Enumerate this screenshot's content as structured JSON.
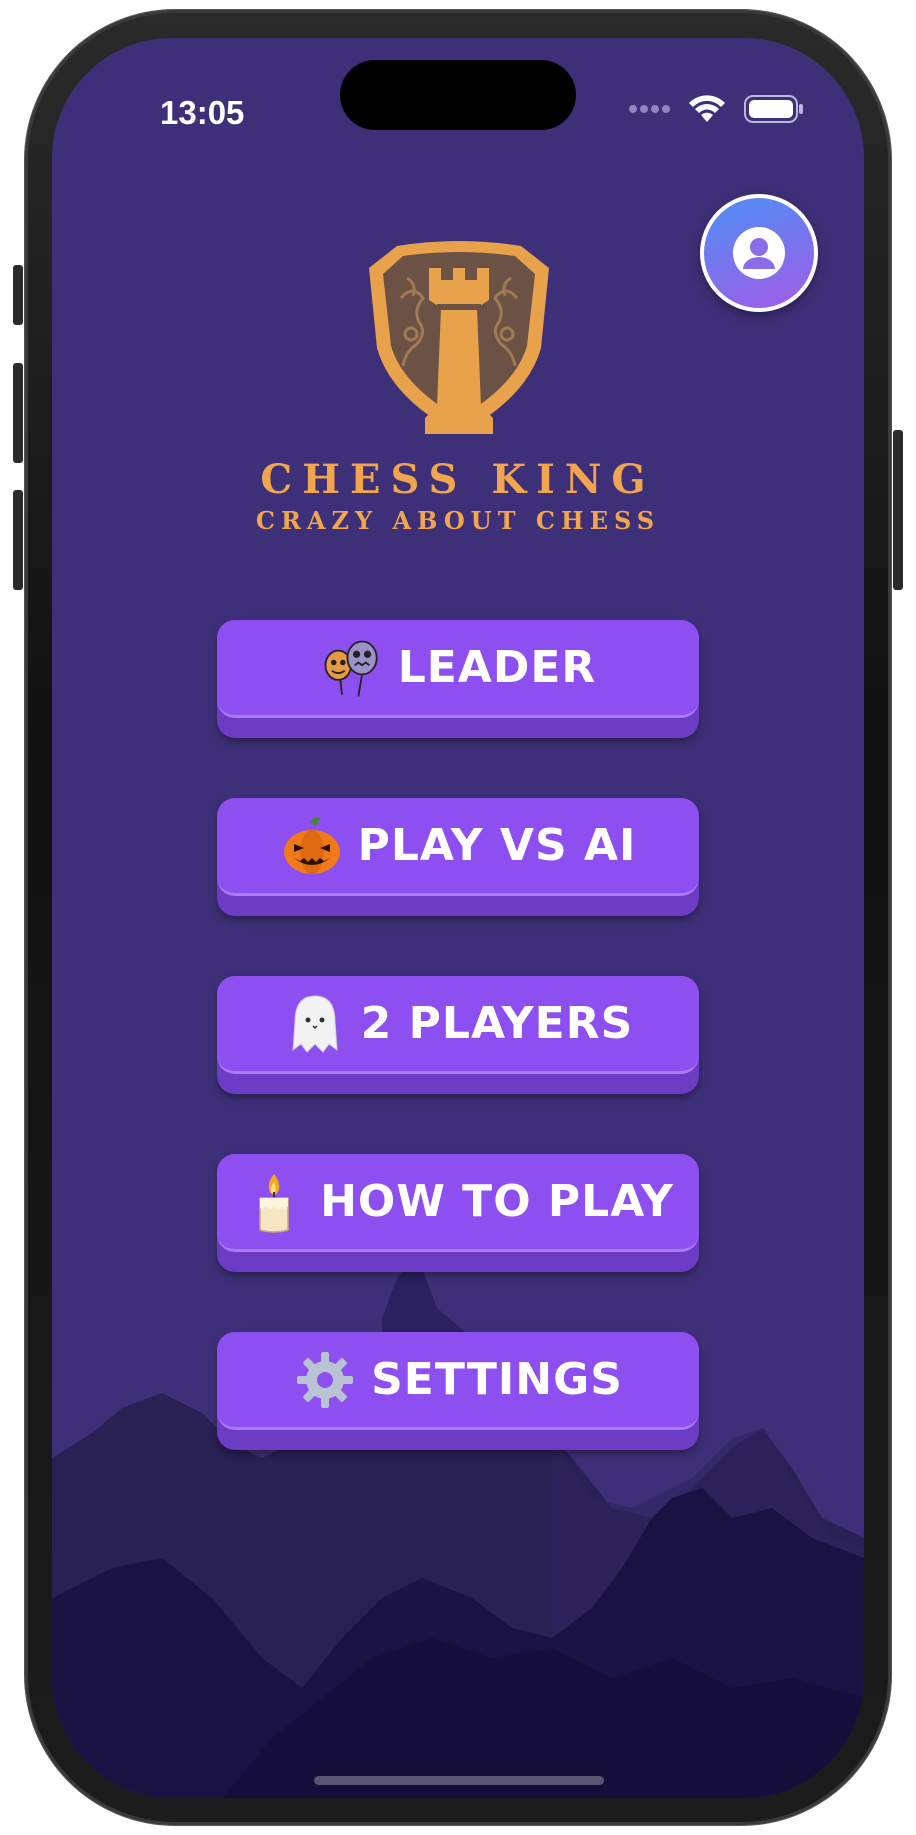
{
  "status_bar": {
    "time": "13:05"
  },
  "app": {
    "title": "CHESS KING",
    "subtitle": "CRAZY ABOUT CHESS"
  },
  "menu": [
    {
      "label": "LEADER",
      "icon": "balloons-icon"
    },
    {
      "label": "PLAY VS AI",
      "icon": "pumpkin-icon"
    },
    {
      "label": "2 PLAYERS",
      "icon": "ghost-icon"
    },
    {
      "label": "HOW TO PLAY",
      "icon": "candle-icon"
    },
    {
      "label": "SETTINGS",
      "icon": "gear-icon"
    }
  ],
  "colors": {
    "background": "#3e3078",
    "button": "#8d4ff0",
    "button_shadow": "#6c3cc4",
    "accent_gold": "#f0a54e"
  }
}
